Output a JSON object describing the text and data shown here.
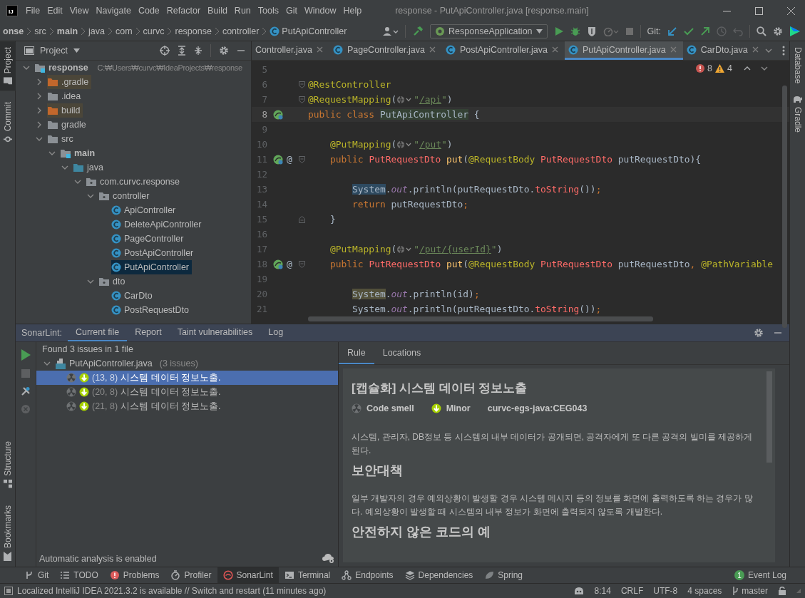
{
  "title_bar": {
    "logo": "IJ",
    "menu": [
      "File",
      "Edit",
      "View",
      "Navigate",
      "Code",
      "Refactor",
      "Build",
      "Run",
      "Tools",
      "Git",
      "Window",
      "Help"
    ],
    "title": "response - PutApiController.java [response.main]"
  },
  "nav_bar": {
    "breadcrumbs": [
      {
        "label": "onse",
        "bold": true,
        "kind": "text"
      },
      {
        "label": "src",
        "bold": false,
        "kind": "text"
      },
      {
        "label": "main",
        "bold": true,
        "kind": "text"
      },
      {
        "label": "java",
        "bold": false,
        "kind": "text"
      },
      {
        "label": "com",
        "bold": false,
        "kind": "text"
      },
      {
        "label": "curvc",
        "bold": false,
        "kind": "text"
      },
      {
        "label": "response",
        "bold": false,
        "kind": "text"
      },
      {
        "label": "controller",
        "bold": false,
        "kind": "text"
      },
      {
        "label": "PutApiController",
        "bold": false,
        "kind": "class"
      }
    ],
    "run_config": "ResponseApplication",
    "git_label": "Git:"
  },
  "left_stripe": {
    "top": [
      {
        "label": "Project",
        "kind": "project",
        "selected": true
      },
      {
        "label": "Commit",
        "kind": "commit",
        "selected": false
      }
    ],
    "bottom": [
      {
        "label": "Structure",
        "kind": "structure",
        "selected": false
      },
      {
        "label": "Bookmarks",
        "kind": "bookmarks",
        "selected": false
      }
    ]
  },
  "right_stripe": [
    {
      "label": "Database",
      "kind": "database"
    },
    {
      "label": "Gradle",
      "kind": "gradle"
    }
  ],
  "project": {
    "title": "Project",
    "tree": [
      {
        "name": "response",
        "kind": "module",
        "path": "C:₩Users₩curvc₩IdeaProjects₩response",
        "expanded": true,
        "selected": false,
        "children": [
          {
            "name": ".gradle",
            "kind": "excluded",
            "expanded": false,
            "selected": false
          },
          {
            "name": ".idea",
            "kind": "folder",
            "expanded": false,
            "selected": false
          },
          {
            "name": "build",
            "kind": "excluded",
            "expanded": false,
            "selected": false
          },
          {
            "name": "gradle",
            "kind": "folder",
            "expanded": false,
            "selected": false
          },
          {
            "name": "src",
            "kind": "folder",
            "expanded": true,
            "selected": false,
            "children": [
              {
                "name": "main",
                "kind": "module",
                "expanded": true,
                "selected": false,
                "children": [
                  {
                    "name": "java",
                    "kind": "source",
                    "expanded": true,
                    "selected": false,
                    "children": [
                      {
                        "name": "com.curvc.response",
                        "kind": "package",
                        "expanded": true,
                        "selected": false,
                        "children": [
                          {
                            "name": "controller",
                            "kind": "package",
                            "expanded": true,
                            "selected": false,
                            "children": [
                              {
                                "name": "ApiController",
                                "kind": "class",
                                "selected": false
                              },
                              {
                                "name": "DeleteApiController",
                                "kind": "class",
                                "selected": false
                              },
                              {
                                "name": "PageController",
                                "kind": "class",
                                "selected": false
                              },
                              {
                                "name": "PostApiController",
                                "kind": "class",
                                "selected": false
                              },
                              {
                                "name": "PutApiController",
                                "kind": "class",
                                "selected": true
                              }
                            ]
                          },
                          {
                            "name": "dto",
                            "kind": "package",
                            "expanded": true,
                            "selected": false,
                            "children": [
                              {
                                "name": "CarDto",
                                "kind": "class",
                                "selected": false
                              },
                              {
                                "name": "PostRequestDto",
                                "kind": "class",
                                "selected": false
                              }
                            ]
                          }
                        ]
                      }
                    ]
                  }
                ]
              }
            ]
          }
        ]
      }
    ]
  },
  "editor": {
    "tabs": [
      {
        "label": "Controller.java",
        "selected": false,
        "icon": false
      },
      {
        "label": "PageController.java",
        "selected": false,
        "icon": true
      },
      {
        "label": "PostApiController.java",
        "selected": false,
        "icon": true
      },
      {
        "label": "PutApiController.java",
        "selected": true,
        "icon": true
      },
      {
        "label": "CarDto.java",
        "selected": false,
        "icon": true
      }
    ],
    "errors": "8",
    "warnings": "4",
    "lines": [
      {
        "number": "5",
        "selected": false
      },
      {
        "number": "6",
        "selected": false,
        "fold_open": true,
        "tokens": [
          {
            "text": "@RestController",
            "kind": "annotation"
          }
        ]
      },
      {
        "number": "7",
        "selected": false,
        "fold_open": true,
        "tokens": [
          {
            "text": "@RequestMapping",
            "kind": "annotation"
          },
          {
            "text": "(",
            "kind": "plain"
          },
          {
            "kind": "hint"
          },
          {
            "text": "\"",
            "kind": "string"
          },
          {
            "text": "/api",
            "kind": "link"
          },
          {
            "text": "\"",
            "kind": "string"
          },
          {
            "text": ")",
            "kind": "plain"
          }
        ]
      },
      {
        "number": "8",
        "selected": true,
        "bean_icon": true,
        "tokens": [
          {
            "text": "public class ",
            "kind": "keyword"
          },
          {
            "text": "PutApiController",
            "kind": "plain",
            "usage_highlight": true
          },
          {
            "text": " {",
            "kind": "plain"
          }
        ]
      },
      {
        "number": "9",
        "selected": false
      },
      {
        "number": "10",
        "selected": false,
        "tokens": [
          {
            "text": "    @PutMapping",
            "kind": "annotation"
          },
          {
            "text": "(",
            "kind": "plain"
          },
          {
            "kind": "hint"
          },
          {
            "text": "\"",
            "kind": "string"
          },
          {
            "text": "/put",
            "kind": "link"
          },
          {
            "text": "\"",
            "kind": "string"
          },
          {
            "text": ")",
            "kind": "plain"
          }
        ]
      },
      {
        "number": "11",
        "selected": false,
        "bean_icon": true,
        "gutter_mark": "@",
        "fold_open": true,
        "tokens": [
          {
            "text": "    public ",
            "kind": "keyword"
          },
          {
            "text": "PutRequestDto",
            "kind": "error"
          },
          {
            "text": " put",
            "kind": "method"
          },
          {
            "text": "(",
            "kind": "plain"
          },
          {
            "text": "@RequestBody ",
            "kind": "annotation"
          },
          {
            "text": "PutRequestDto",
            "kind": "error"
          },
          {
            "text": " putRequestDto){",
            "kind": "plain"
          }
        ]
      },
      {
        "number": "12",
        "selected": false
      },
      {
        "number": "13",
        "selected": false,
        "tokens": [
          {
            "text": "        System",
            "kind": "plain",
            "issue_highlight": true,
            "selected": true
          },
          {
            "text": ".",
            "kind": "plain"
          },
          {
            "text": "out",
            "kind": "field"
          },
          {
            "text": ".println(putRequestDto.",
            "kind": "plain"
          },
          {
            "text": "toString",
            "kind": "error"
          },
          {
            "text": "())",
            "kind": "plain"
          },
          {
            "text": ";",
            "kind": "keyword"
          }
        ]
      },
      {
        "number": "14",
        "selected": false,
        "tokens": [
          {
            "text": "        return ",
            "kind": "keyword"
          },
          {
            "text": "putRequestDto",
            "kind": "plain"
          },
          {
            "text": ";",
            "kind": "keyword"
          }
        ]
      },
      {
        "number": "15",
        "selected": false,
        "fold_close": true,
        "tokens": [
          {
            "text": "    }",
            "kind": "plain"
          }
        ]
      },
      {
        "number": "16",
        "selected": false
      },
      {
        "number": "17",
        "selected": false,
        "tokens": [
          {
            "text": "    @PutMapping",
            "kind": "annotation"
          },
          {
            "text": "(",
            "kind": "plain"
          },
          {
            "kind": "hint"
          },
          {
            "text": "\"",
            "kind": "string"
          },
          {
            "text": "/put/{userId}",
            "kind": "link"
          },
          {
            "text": "\"",
            "kind": "string"
          },
          {
            "text": ")",
            "kind": "plain"
          }
        ]
      },
      {
        "number": "18",
        "selected": false,
        "bean_icon": true,
        "gutter_mark": "@",
        "fold_open": true,
        "tokens": [
          {
            "text": "    public ",
            "kind": "keyword"
          },
          {
            "text": "PutRequestDto",
            "kind": "error"
          },
          {
            "text": " put",
            "kind": "method"
          },
          {
            "text": "(",
            "kind": "plain"
          },
          {
            "text": "@RequestBody ",
            "kind": "annotation"
          },
          {
            "text": "PutRequestDto",
            "kind": "error"
          },
          {
            "text": " putRequestDto",
            "kind": "plain"
          },
          {
            "text": ", ",
            "kind": "keyword"
          },
          {
            "text": "@PathVariable",
            "kind": "annotation"
          }
        ]
      },
      {
        "number": "19",
        "selected": false
      },
      {
        "number": "20",
        "selected": false,
        "tokens": [
          {
            "text": "        System",
            "kind": "plain",
            "issue_highlight": true,
            "selected": false
          },
          {
            "text": ".",
            "kind": "plain"
          },
          {
            "text": "out",
            "kind": "field"
          },
          {
            "text": ".println(id)",
            "kind": "plain"
          },
          {
            "text": ";",
            "kind": "keyword"
          }
        ]
      },
      {
        "number": "21",
        "selected": false,
        "tokens": [
          {
            "text": "        System.",
            "kind": "plain"
          },
          {
            "text": "out",
            "kind": "field"
          },
          {
            "text": ".println(putRequestDto.",
            "kind": "plain"
          },
          {
            "text": "toString",
            "kind": "error"
          },
          {
            "text": "())",
            "kind": "plain"
          },
          {
            "text": ";",
            "kind": "keyword"
          }
        ]
      }
    ]
  },
  "sonarlint": {
    "label": "SonarLint:",
    "tabs": [
      {
        "label": "Current file",
        "selected": true
      },
      {
        "label": "Report",
        "selected": false
      },
      {
        "label": "Taint vulnerabilities",
        "selected": false
      },
      {
        "label": "Log",
        "selected": false
      }
    ],
    "summary": "Found 3 issues in 1 file",
    "file": {
      "name": "PutApiController.java",
      "count": "(3 issues)",
      "expanded": true
    },
    "issues": [
      {
        "location": "(13, 8)",
        "message": "시스템 데이터 정보노출.",
        "selected": true
      },
      {
        "location": "(20, 8)",
        "message": "시스템 데이터 정보노출.",
        "selected": false
      },
      {
        "location": "(21, 8)",
        "message": "시스템 데이터 정보노출.",
        "selected": false
      }
    ],
    "status": "Automatic analysis is enabled",
    "rule": {
      "tabs": [
        {
          "label": "Rule",
          "selected": true
        },
        {
          "label": "Locations",
          "selected": false
        }
      ],
      "title": "[캡슐화] 시스템 데이터 정보노출",
      "type": "Code smell",
      "severity": "Minor",
      "key": "curvc-egs-java:CEG043",
      "sections": [
        {
          "kind": "p",
          "text": "시스템, 관리자, DB정보 등 시스템의 내부 데이터가 공개되면, 공격자에게 또 다른 공격의 빌미를 제공하게 된다."
        },
        {
          "kind": "h",
          "text": "보안대책"
        },
        {
          "kind": "p",
          "text": "일부 개발자의 경우 예외상황이 발생할 경우 시스템 메시지 등의 정보를 화면에 출력하도록 하는 경우가 많다. 예외상황이 발생할 때 시스템의 내부 정보가 화면에 출력되지 않도록 개발한다."
        },
        {
          "kind": "h",
          "text": "안전하지 않은 코드의 예"
        }
      ]
    }
  },
  "tool_bar": [
    {
      "label": "Git",
      "kind": "git",
      "selected": false
    },
    {
      "label": "TODO",
      "kind": "todo",
      "selected": false
    },
    {
      "label": "Problems",
      "kind": "problems",
      "selected": false
    },
    {
      "label": "Profiler",
      "kind": "profiler",
      "selected": false
    },
    {
      "label": "SonarLint",
      "kind": "sonarlint",
      "selected": true
    },
    {
      "label": "Terminal",
      "kind": "terminal",
      "selected": false
    },
    {
      "label": "Endpoints",
      "kind": "endpoints",
      "selected": false
    },
    {
      "label": "Dependencies",
      "kind": "dependencies",
      "selected": false
    },
    {
      "label": "Spring",
      "kind": "spring",
      "selected": false
    }
  ],
  "event_log": {
    "label": "Event Log",
    "count": "1"
  },
  "status_bar": {
    "message": "Localized IntelliJ IDEA 2021.3.2 is available // Switch and restart (11 minutes ago)",
    "items": [
      "8:14",
      "CRLF",
      "UTF-8",
      "4 spaces"
    ],
    "branch": "master"
  }
}
